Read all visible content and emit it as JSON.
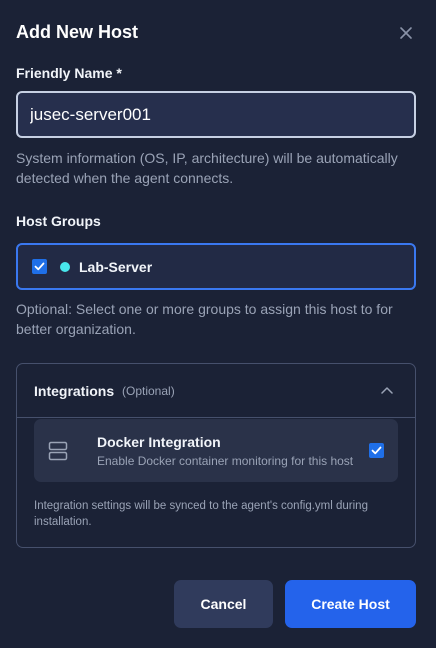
{
  "dialog": {
    "title": "Add New Host"
  },
  "friendly_name": {
    "label": "Friendly Name *",
    "value": "jusec-server001",
    "help": "System information (OS, IP, architecture) will be automatically detected when the agent connects."
  },
  "host_groups": {
    "label": "Host Groups",
    "items": [
      {
        "label": "Lab-Server",
        "checked": true,
        "color": "#48e6ec"
      }
    ],
    "help": "Optional: Select one or more groups to assign this host to for better organization."
  },
  "integrations": {
    "title": "Integrations",
    "optional_tag": "(Optional)",
    "expanded": true,
    "docker": {
      "title": "Docker Integration",
      "description": "Enable Docker container monitoring for this host",
      "checked": true,
      "icon": "server-icon"
    },
    "note": "Integration settings will be synced to the agent's config.yml during installation."
  },
  "actions": {
    "cancel_label": "Cancel",
    "create_label": "Create Host"
  },
  "colors": {
    "background": "#1b2236",
    "accent": "#2463eb",
    "focus_border": "#3a78f0",
    "group_dot": "#48e6ec"
  }
}
